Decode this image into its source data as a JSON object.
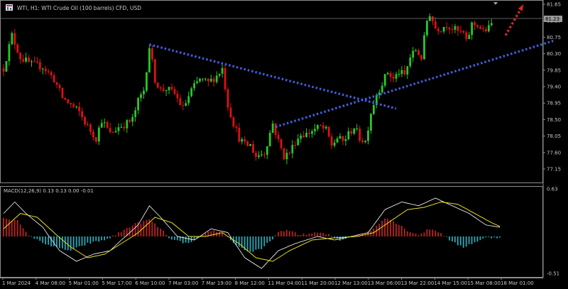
{
  "window": {
    "title": "WTI, H1:  WTI Crude Oil (100 barrels) CFD, USD",
    "icon": "chart-window-icon"
  },
  "colors": {
    "background": "#000000",
    "bull_candle": "#26c926",
    "bear_candle": "#e01010",
    "axis_text": "#c8c8c8",
    "trendline": "#3f5fe0",
    "arrow": "#e02424",
    "macd_hist_pos": "#c02020",
    "macd_hist_neg": "#2aa8b8",
    "macd_line": "#ffffff",
    "signal_line": "#e8e020",
    "price_tag_bg": "#9a9a9a"
  },
  "price_tag": "81.23",
  "chart_data": [
    {
      "type": "candlestick",
      "title": "WTI, H1:  WTI Crude Oil (100 barrels) CFD, USD",
      "ylim": [
        76.9,
        81.65
      ],
      "y_ticks": [
        "81.65",
        "81.20",
        "80.75",
        "80.30",
        "79.85",
        "79.40",
        "78.95",
        "78.50",
        "78.05",
        "77.60",
        "77.15"
      ],
      "x_ticks": [
        "1 Mar 2024",
        "4 Mar 08:00",
        "5 Mar 01:00",
        "5 Mar 17:00",
        "6 Mar 10:00",
        "7 Mar 03:00",
        "7 Mar 19:00",
        "8 Mar 12:00",
        "11 Mar 04:00",
        "11 Mar 20:00",
        "12 Mar 13:00",
        "13 Mar 06:00",
        "13 Mar 22:00",
        "14 Mar 15:00",
        "15 Mar 08:00",
        "18 Mar 01:00"
      ],
      "close_path": [
        [
          0,
          79.9
        ],
        [
          3,
          80.8
        ],
        [
          6,
          80.2
        ],
        [
          10,
          80.0
        ],
        [
          14,
          79.95
        ],
        [
          18,
          79.6
        ],
        [
          21,
          79.1
        ],
        [
          24,
          78.9
        ],
        [
          27,
          78.7
        ],
        [
          30,
          78.3
        ],
        [
          33,
          78.0
        ],
        [
          35,
          78.5
        ],
        [
          38,
          78.1
        ],
        [
          41,
          78.3
        ],
        [
          44,
          78.4
        ],
        [
          46,
          78.5
        ],
        [
          48,
          79.0
        ],
        [
          50,
          79.3
        ],
        [
          52,
          80.5
        ],
        [
          54,
          79.6
        ],
        [
          56,
          79.3
        ],
        [
          58,
          79.35
        ],
        [
          61,
          79.2
        ],
        [
          64,
          78.8
        ],
        [
          67,
          79.3
        ],
        [
          70,
          79.6
        ],
        [
          73,
          79.5
        ],
        [
          76,
          79.7
        ],
        [
          78,
          79.9
        ],
        [
          80,
          78.9
        ],
        [
          82,
          78.4
        ],
        [
          84,
          78.0
        ],
        [
          86,
          77.8
        ],
        [
          88,
          77.8
        ],
        [
          90,
          77.5
        ],
        [
          93,
          77.6
        ],
        [
          96,
          78.4
        ],
        [
          98,
          77.9
        ],
        [
          100,
          77.5
        ],
        [
          102,
          77.6
        ],
        [
          104,
          77.9
        ],
        [
          106,
          78.1
        ],
        [
          108,
          78.1
        ],
        [
          110,
          78.2
        ],
        [
          113,
          78.3
        ],
        [
          115,
          78.2
        ],
        [
          117,
          77.8
        ],
        [
          119,
          78.0
        ],
        [
          121,
          77.9
        ],
        [
          123,
          78.1
        ],
        [
          125,
          78.3
        ],
        [
          127,
          78.0
        ],
        [
          129,
          77.9
        ],
        [
          131,
          78.7
        ],
        [
          133,
          79.2
        ],
        [
          135,
          79.5
        ],
        [
          137,
          79.8
        ],
        [
          139,
          79.6
        ],
        [
          141,
          79.8
        ],
        [
          143,
          79.7
        ],
        [
          145,
          80.2
        ],
        [
          147,
          80.4
        ],
        [
          149,
          80.2
        ],
        [
          151,
          81.2
        ],
        [
          152,
          81.4
        ],
        [
          154,
          81.0
        ],
        [
          156,
          81.0
        ],
        [
          158,
          81.1
        ],
        [
          160,
          81.0
        ],
        [
          162,
          80.9
        ],
        [
          164,
          80.85
        ],
        [
          165,
          80.6
        ],
        [
          167,
          81.1
        ],
        [
          169,
          81.1
        ],
        [
          171,
          80.9
        ],
        [
          173,
          81.0
        ],
        [
          174,
          81.1
        ]
      ],
      "annotations": [
        {
          "type": "trendline",
          "style": "dotted",
          "from": [
            52,
            80.55
          ],
          "to": [
            140,
            78.8
          ]
        },
        {
          "type": "trendline",
          "style": "dotted",
          "from": [
            97,
            78.3
          ],
          "to": [
            196,
            80.65
          ]
        },
        {
          "type": "arrow",
          "style": "dotted",
          "from": [
            179,
            80.8
          ],
          "to": [
            185,
            81.6
          ]
        }
      ]
    },
    {
      "type": "macd",
      "title": "MACD(12,26,9) 0.13 0.13 0.00 -0.01",
      "params": [
        12,
        26,
        9
      ],
      "ylim": [
        -0.51,
        0.63
      ],
      "y_ticks": [
        "0.63",
        "-0.51"
      ],
      "macd_path": [
        [
          0,
          0.3
        ],
        [
          4,
          0.45
        ],
        [
          8,
          0.3
        ],
        [
          14,
          0.12
        ],
        [
          20,
          -0.2
        ],
        [
          26,
          -0.35
        ],
        [
          32,
          -0.25
        ],
        [
          38,
          -0.2
        ],
        [
          42,
          -0.05
        ],
        [
          48,
          0.15
        ],
        [
          52,
          0.4
        ],
        [
          56,
          0.25
        ],
        [
          62,
          0.0
        ],
        [
          68,
          -0.05
        ],
        [
          74,
          0.1
        ],
        [
          80,
          0.05
        ],
        [
          86,
          -0.3
        ],
        [
          92,
          -0.45
        ],
        [
          98,
          -0.2
        ],
        [
          104,
          -0.1
        ],
        [
          112,
          0.0
        ],
        [
          118,
          -0.05
        ],
        [
          124,
          0.0
        ],
        [
          130,
          0.05
        ],
        [
          136,
          0.35
        ],
        [
          142,
          0.45
        ],
        [
          148,
          0.4
        ],
        [
          154,
          0.5
        ],
        [
          160,
          0.4
        ],
        [
          166,
          0.3
        ],
        [
          172,
          0.15
        ],
        [
          177,
          0.12
        ]
      ],
      "signal_path": [
        [
          0,
          0.1
        ],
        [
          6,
          0.3
        ],
        [
          12,
          0.25
        ],
        [
          18,
          0.05
        ],
        [
          24,
          -0.15
        ],
        [
          30,
          -0.3
        ],
        [
          36,
          -0.25
        ],
        [
          42,
          -0.1
        ],
        [
          48,
          0.05
        ],
        [
          54,
          0.25
        ],
        [
          60,
          0.18
        ],
        [
          66,
          0.0
        ],
        [
          72,
          0.0
        ],
        [
          78,
          0.05
        ],
        [
          84,
          -0.1
        ],
        [
          90,
          -0.3
        ],
        [
          96,
          -0.35
        ],
        [
          102,
          -0.2
        ],
        [
          110,
          -0.05
        ],
        [
          118,
          -0.02
        ],
        [
          126,
          0.0
        ],
        [
          132,
          0.05
        ],
        [
          138,
          0.2
        ],
        [
          144,
          0.35
        ],
        [
          150,
          0.38
        ],
        [
          156,
          0.45
        ],
        [
          162,
          0.42
        ],
        [
          168,
          0.3
        ],
        [
          174,
          0.18
        ],
        [
          177,
          0.13
        ]
      ],
      "histogram_sign_path": [
        [
          0,
          0.25
        ],
        [
          5,
          0.2
        ],
        [
          8,
          0.05
        ],
        [
          12,
          -0.05
        ],
        [
          18,
          -0.15
        ],
        [
          24,
          -0.2
        ],
        [
          30,
          -0.1
        ],
        [
          36,
          -0.05
        ],
        [
          40,
          0.02
        ],
        [
          46,
          0.15
        ],
        [
          52,
          0.22
        ],
        [
          56,
          0.1
        ],
        [
          60,
          -0.05
        ],
        [
          66,
          -0.1
        ],
        [
          70,
          -0.02
        ],
        [
          74,
          0.08
        ],
        [
          78,
          0.05
        ],
        [
          84,
          -0.15
        ],
        [
          88,
          -0.22
        ],
        [
          92,
          -0.18
        ],
        [
          98,
          0.05
        ],
        [
          102,
          0.08
        ],
        [
          106,
          0.02
        ],
        [
          112,
          0.05
        ],
        [
          116,
          0.02
        ],
        [
          120,
          -0.05
        ],
        [
          124,
          0.0
        ],
        [
          128,
          0.02
        ],
        [
          132,
          0.1
        ],
        [
          136,
          0.25
        ],
        [
          140,
          0.18
        ],
        [
          144,
          0.08
        ],
        [
          148,
          0.02
        ],
        [
          152,
          0.1
        ],
        [
          156,
          0.05
        ],
        [
          160,
          -0.08
        ],
        [
          164,
          -0.15
        ],
        [
          168,
          -0.08
        ],
        [
          172,
          -0.02
        ],
        [
          177,
          -0.01
        ]
      ]
    }
  ]
}
